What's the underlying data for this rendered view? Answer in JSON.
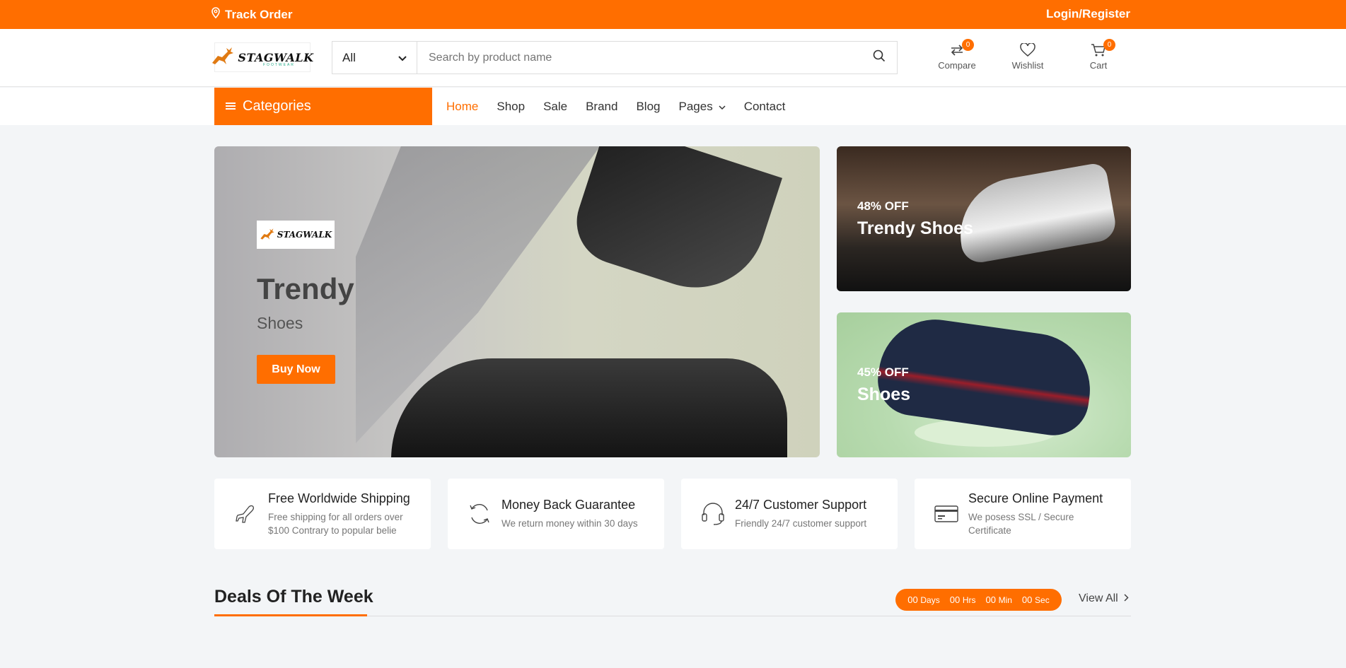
{
  "topbar": {
    "track_label": "Track Order",
    "login_label": "Login/Register"
  },
  "header": {
    "logo_text": "STAGWALK",
    "logo_sub": "FOOTWEAR",
    "search": {
      "category": "All",
      "placeholder": "Search by product name"
    },
    "compare": {
      "label": "Compare",
      "count": "0"
    },
    "wishlist": {
      "label": "Wishlist"
    },
    "cart": {
      "label": "Cart",
      "count": "0"
    }
  },
  "nav": {
    "categories_label": "Categories",
    "items": [
      "Home",
      "Shop",
      "Sale",
      "Brand",
      "Blog",
      "Pages",
      "Contact"
    ]
  },
  "hero": {
    "logo_text": "STAGWALK",
    "title": "Trendy",
    "subtitle": "Shoes",
    "button": "Buy Now"
  },
  "promos": [
    {
      "off": "48% OFF",
      "title": "Trendy Shoes"
    },
    {
      "off": "45% OFF",
      "title": "Shoes"
    }
  ],
  "features": [
    {
      "title": "Free Worldwide Shipping",
      "desc": "Free shipping for all orders over $100 Contrary to popular belie",
      "icon": "airplane-icon"
    },
    {
      "title": "Money Back Guarantee",
      "desc": "We return money within 30 days",
      "icon": "refresh-icon"
    },
    {
      "title": "24/7 Customer Support",
      "desc": "Friendly 24/7 customer support",
      "icon": "headset-icon"
    },
    {
      "title": "Secure Online Payment",
      "desc": "We posess SSL / Secure Certificate",
      "icon": "credit-card-icon"
    }
  ],
  "deals": {
    "title": "Deals Of The Week",
    "timer": {
      "days": "00",
      "days_label": "Days",
      "hrs": "00",
      "hrs_label": "Hrs",
      "min": "00",
      "min_label": "Min",
      "sec": "00",
      "sec_label": "Sec"
    },
    "view_all": "View All"
  },
  "colors": {
    "accent": "#ff6e00",
    "background": "#f3f5f7"
  }
}
